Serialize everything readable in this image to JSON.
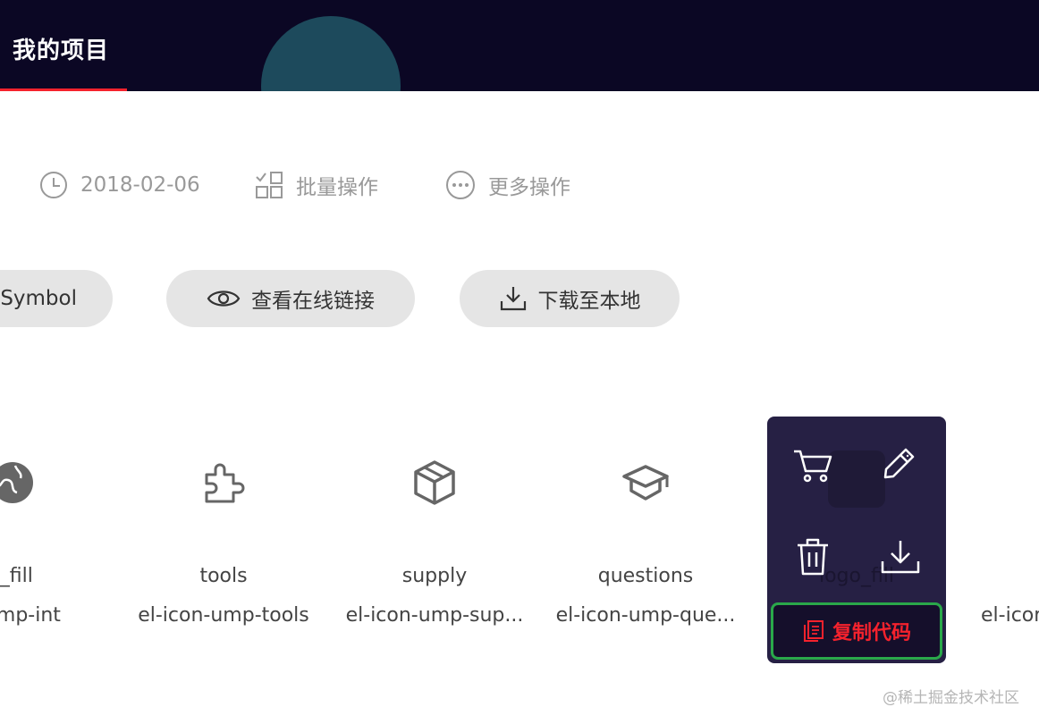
{
  "header": {
    "active_tab": "我的项目",
    "colors": {
      "background": "#0b0724",
      "accent": "#f5222d"
    }
  },
  "meta": {
    "date": "2018-02-06",
    "batch_label": "批量操作",
    "more_label": "更多操作"
  },
  "actions": {
    "symbol_label": "Symbol",
    "view_link_label": "查看在线链接",
    "download_label": "下载至本地"
  },
  "icons": [
    {
      "name": "t_fill",
      "code": "n-ump-int",
      "icon": "globe-icon"
    },
    {
      "name": "tools",
      "code": "el-icon-ump-tools",
      "icon": "puzzle-icon"
    },
    {
      "name": "supply",
      "code": "el-icon-ump-sup...",
      "icon": "box-icon"
    },
    {
      "name": "questions",
      "code": "el-icon-ump-que...",
      "icon": "graduation-cap-icon"
    },
    {
      "name": "logo_fill",
      "icon": "logo-icon"
    },
    {
      "code": "el-icor"
    }
  ],
  "overlay": {
    "copy_label": "复制代码",
    "icons": [
      "cart-icon",
      "edit-icon",
      "trash-icon",
      "download-icon",
      "copy-icon"
    ],
    "colors": {
      "background": "#262044",
      "copy_text": "#f5222d",
      "copy_border": "#2aa84a"
    }
  },
  "watermark": "@稀土掘金技术社区"
}
